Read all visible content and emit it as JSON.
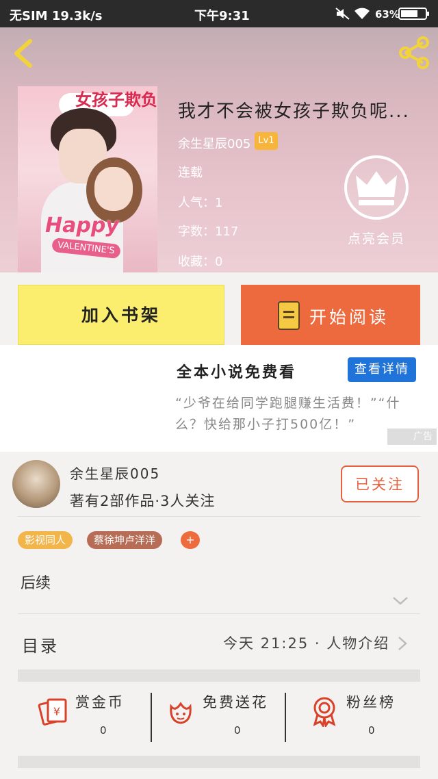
{
  "status_bar": {
    "carrier": "无SIM 19.3k/s",
    "time": "下午9:31",
    "battery": "63%"
  },
  "book": {
    "cover_title": "女孩子欺负",
    "cover_happy": "Happy",
    "cover_valentine": "VALENTINE'S",
    "title": "我才不会被女孩子欺负呢...",
    "author": "余生星辰005",
    "level": "Lv1",
    "status": "连载",
    "popularity": "人气：1",
    "word_count": "字数：117",
    "favorites": "收藏：0"
  },
  "vip": {
    "label": "点亮会员"
  },
  "actions": {
    "add_shelf": "加入书架",
    "start_read": "开始阅读"
  },
  "ad": {
    "title": "全本小说免费看",
    "detail_button": "查看详情",
    "description": "“少爷在给同学跑腿赚生活费！”“什么？快给那小子打500亿！”",
    "tag": "广告"
  },
  "author_card": {
    "name": "余生星辰005",
    "works": "著有2部作品·3人关注",
    "follow_button": "已关注"
  },
  "tags": [
    "影视同人",
    "蔡徐坤卢洋洋",
    "+"
  ],
  "sequel": {
    "label": "后续"
  },
  "toc": {
    "label": "目录",
    "latest": "今天 21:25 · 人物介绍"
  },
  "gifts": [
    {
      "label": "赏金币",
      "count": "0"
    },
    {
      "label": "免费送花",
      "count": "0"
    },
    {
      "label": "粉丝榜",
      "count": "0"
    }
  ],
  "colors": {
    "accent_orange": "#ec6a3e",
    "shelf_yellow": "#fbee6e",
    "ad_blue": "#1f73d9",
    "level_badge": "#f7b53b"
  }
}
